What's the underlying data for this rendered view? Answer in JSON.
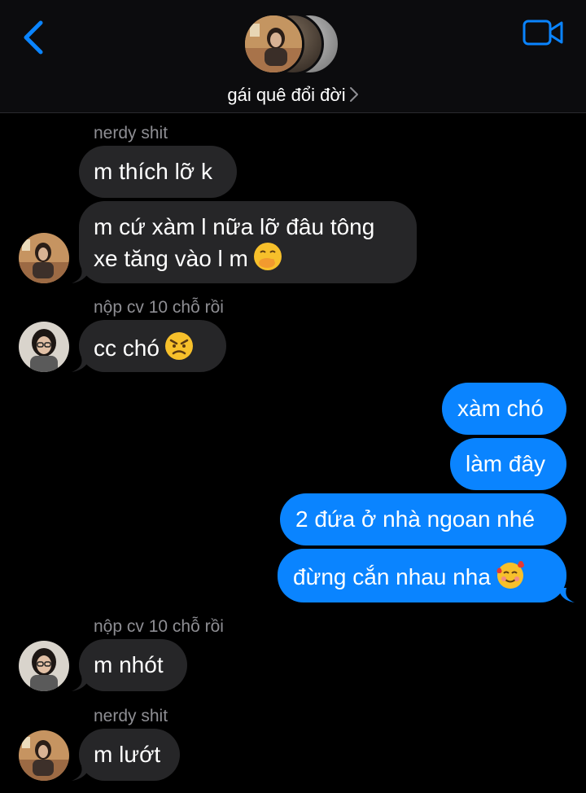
{
  "header": {
    "title": "gái quê đổi đời"
  },
  "colors": {
    "accent": "#0a84ff",
    "incoming_bubble": "#262628",
    "sender_label": "#8e8e93",
    "background": "#000000"
  },
  "icons": {
    "back": "chevron-left-icon",
    "video": "video-camera-icon",
    "title_chevron": "chevron-right-icon"
  },
  "messages": {
    "m1_sender": "nerdy shit",
    "m1_text": "m thích lỡ k",
    "m2_text1": "m cứ xàm l nữa lỡ đâu tông",
    "m2_text2": "xe tăng vào l m",
    "m3_sender": "nộp cv 10 chỗ rồi",
    "m3_text": "cc chó",
    "out1": "xàm chó",
    "out2": "làm đây",
    "out3": "2 đứa ở nhà ngoan nhé",
    "out4": "đừng cắn nhau nha",
    "m4_sender": "nộp cv 10 chỗ rồi",
    "m4_text": "m nhót",
    "m5_sender": "nerdy shit",
    "m5_text": "m lướt"
  }
}
